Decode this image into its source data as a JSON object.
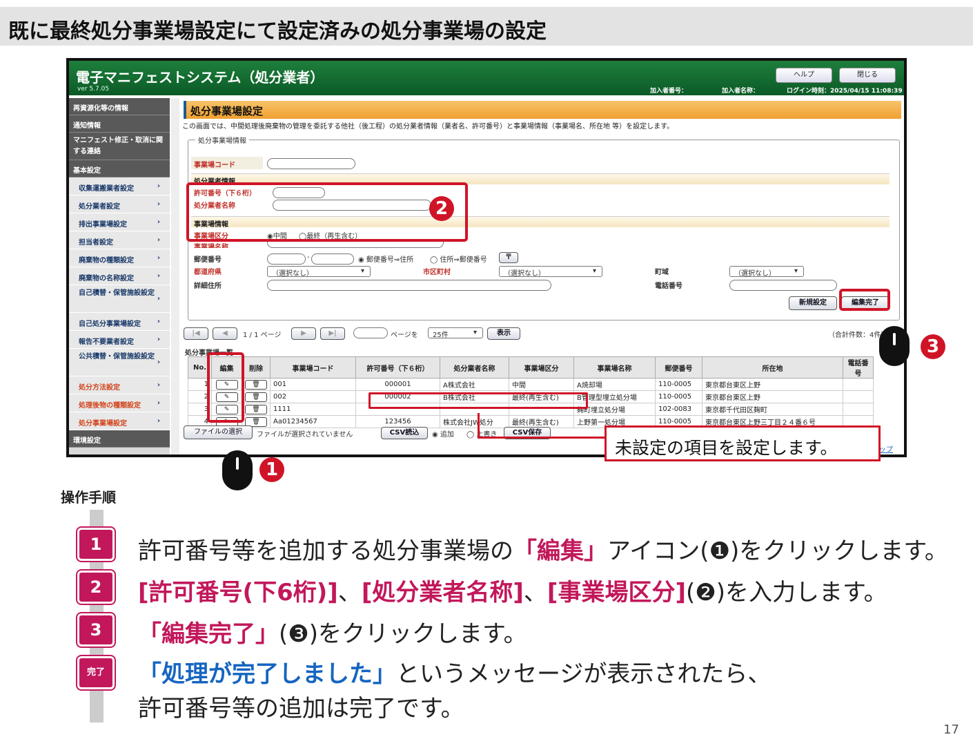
{
  "page_title": "既に最終処分事業場設定にて設定済みの処分事業場の設定",
  "app": {
    "title": "電子マニフェストシステム（処分業者）",
    "version": "ver 5.7.05",
    "help_label": "ヘルプ",
    "close_label": "閉じる",
    "member_no_label": "加入者番号：",
    "member_name_label": "加入者名称：",
    "login_time": "ログイン時刻：2025/04/15 11:08:39"
  },
  "sidebar": {
    "recycle": "再資源化等の情報",
    "notice": "通知情報",
    "correction": "マニフェスト修正・取消に関する連絡",
    "basic": "基本設定",
    "items": [
      {
        "label": "収集運搬業者設定"
      },
      {
        "label": "処分業者設定"
      },
      {
        "label": "排出事業場設定"
      },
      {
        "label": "担当者設定"
      },
      {
        "label": "廃棄物の種類設定"
      },
      {
        "label": "廃棄物の名称設定"
      },
      {
        "label": "自己積替・保管施設設定"
      },
      {
        "label": "自己処分事業場設定"
      },
      {
        "label": "報告不要業者設定"
      },
      {
        "label": "公共積替・保管施設設定"
      },
      {
        "label": "処分方法設定"
      },
      {
        "label": "処理後物の種類設定"
      },
      {
        "label": "処分事業場設定"
      }
    ],
    "env": "環境設定"
  },
  "form": {
    "section_title": "処分事業場設定",
    "description": "この画面では、中間処理後廃棄物の管理を委託する他社（後工程）の処分業者情報（業者名、許可番号）と事業場情報（事業場名、所在地 等）を設定します。",
    "legend": "処分事業場情報",
    "code_label": "事業場コード",
    "company_group": "処分業者情報",
    "permit_label": "許可番号（下６桁）",
    "company_name_label": "処分業者名称",
    "site_group": "事業場情報",
    "site_type_label": "事業場区分",
    "site_type_mid": "◉中間",
    "site_type_final": "◯最終（再生含む）",
    "site_name_label": "事業場名称",
    "zip_label": "郵便番号",
    "zip_dash": "-",
    "zip_to_addr": "◉ 郵便番号⇒住所",
    "addr_to_zip": "◯ 住所⇒郵便番号",
    "zip_btn": "〒",
    "pref_label": "都道府県",
    "pref_value": "（選択なし）",
    "city_label": "市区町村",
    "city_value": "（選択なし）",
    "town_label": "町域",
    "town_value": "（選択なし）",
    "address_label": "詳細住所",
    "phone_label": "電話番号",
    "new_btn": "新規設定",
    "done_btn": "編集完了"
  },
  "pager": {
    "first": "|◀",
    "prev": "◀",
    "page_info": "1 / 1 ページ",
    "next": "▶",
    "last": "▶|",
    "page_to": "ページを",
    "per_page": "25件",
    "show_btn": "表示",
    "total": "（合計件数：4件）"
  },
  "list": {
    "title": "処分事業場一覧",
    "headers": [
      "No.",
      "編集",
      "削除",
      "事業場コード",
      "許可番号（下６桁）",
      "処分業者名称",
      "事業場区分",
      "事業場名称",
      "郵便番号",
      "所在地",
      "電話番号"
    ],
    "rows": [
      {
        "no": "1",
        "code": "001",
        "permit": "000001",
        "company": "A株式会社",
        "type": "中間",
        "site": "A焼却場",
        "zip": "110-0005",
        "addr": "東京都台東区上野"
      },
      {
        "no": "2",
        "code": "002",
        "permit": "000002",
        "company": "B株式会社",
        "type": "最終(再生含む)",
        "site": "B管理型埋立処分場",
        "zip": "110-0005",
        "addr": "東京都台東区上野"
      },
      {
        "no": "3",
        "code": "1111",
        "permit": "",
        "company": "",
        "type": "",
        "site": "麹町埋立処分場",
        "zip": "102-0083",
        "addr": "東京都千代田区麹町"
      },
      {
        "no": "4",
        "code": "Aa01234567",
        "permit": "123456",
        "company": "株式会社JW処分",
        "type": "最終(再生含む)",
        "site": "上野第一処分場",
        "zip": "110-0005",
        "addr": "東京都台東区上野三丁目２４番６号"
      }
    ]
  },
  "footer": {
    "file_btn": "ファイルの選択",
    "no_file": "ファイルが選択されていません",
    "csv_in": "CSV読込",
    "append": "◉ 追加",
    "overwrite": "◯ 上書き",
    "csv_save": "CSV保存",
    "page_top": "ップ"
  },
  "callout": "未設定の項目を設定します。",
  "markers": {
    "m1": "1",
    "m2": "2",
    "m3": "3"
  },
  "steps": {
    "heading": "操作手順",
    "s1_badge": "1",
    "s1_a": "許可番号等を追加する処分事業場の",
    "s1_b": "「編集」",
    "s1_c": "アイコン(❶)をクリックします。",
    "s2_badge": "2",
    "s2_a": "[許可番号(下6桁)]",
    "s2_b": "、",
    "s2_c": "[処分業者名称]",
    "s2_d": "、",
    "s2_e": "[事業場区分]",
    "s2_f": "(❷)を入力します。",
    "s3_badge": "3",
    "s3_a": "「編集完了」",
    "s3_b": "(❸)をクリックします。",
    "s4_badge": "完了",
    "s4_a": "「処理が完了しました」",
    "s4_b": "というメッセージが表示されたら、",
    "s4_c": "許可番号等の追加は完了です。"
  },
  "page_number": "17",
  "colors": {
    "accent": "#d01427",
    "header_green": "#0b5a26",
    "step_pink": "#c2185b",
    "step_blue": "#1565c0"
  }
}
